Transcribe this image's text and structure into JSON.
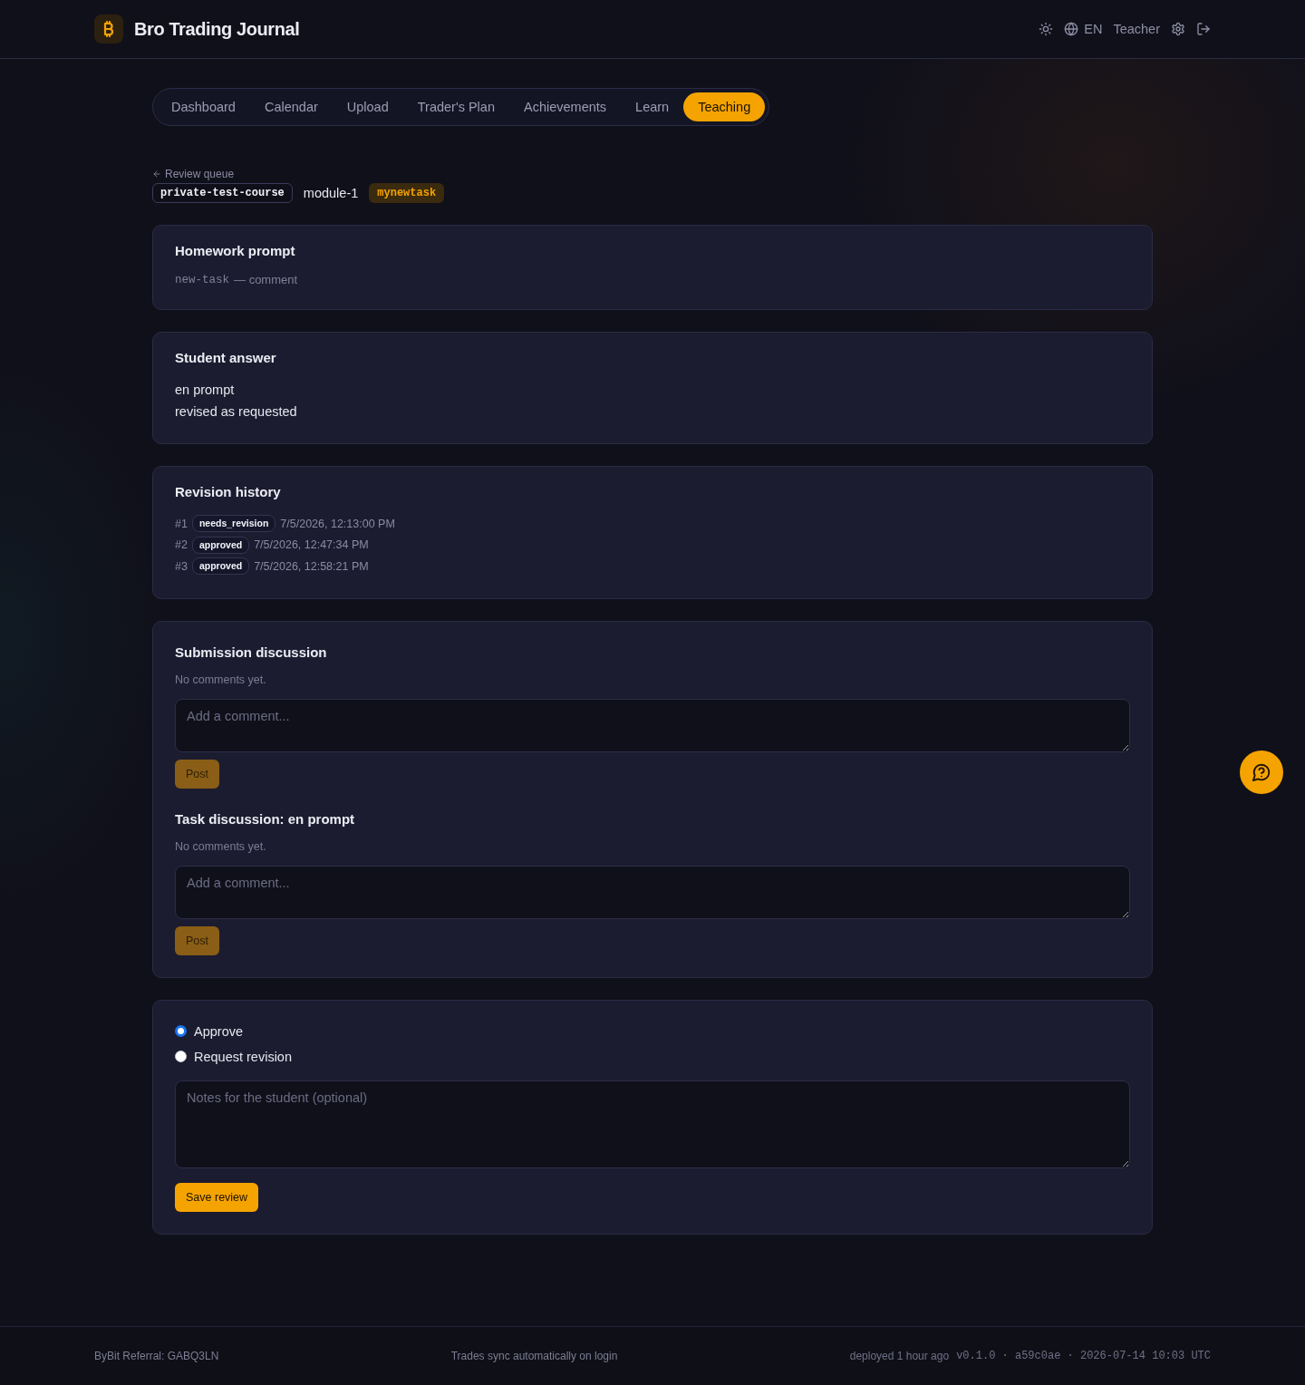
{
  "header": {
    "title": "Bro Trading Journal",
    "language": "EN",
    "role": "Teacher"
  },
  "nav": {
    "tabs": [
      {
        "label": "Dashboard",
        "selected": false
      },
      {
        "label": "Calendar",
        "selected": false
      },
      {
        "label": "Upload",
        "selected": false
      },
      {
        "label": "Trader's Plan",
        "selected": false
      },
      {
        "label": "Achievements",
        "selected": false
      },
      {
        "label": "Learn",
        "selected": false
      },
      {
        "label": "Teaching",
        "selected": true
      }
    ]
  },
  "breadcrumb": {
    "back_link": "Review queue",
    "course": "private-test-course",
    "module": "module-1",
    "task": "mynewtask"
  },
  "homework_prompt": {
    "title": "Homework prompt",
    "task": "new-task",
    "comment": "— comment"
  },
  "student_answer": {
    "title": "Student answer",
    "lines": [
      "en prompt",
      "revised as requested"
    ]
  },
  "revision_history": {
    "title": "Revision history",
    "entries": [
      {
        "number": "#1",
        "status": "needs_revision",
        "date": "7/5/2026, 12:13:00 PM"
      },
      {
        "number": "#2",
        "status": "approved",
        "date": "7/5/2026, 12:47:34 PM"
      },
      {
        "number": "#3",
        "status": "approved",
        "date": "7/5/2026, 12:58:21 PM"
      }
    ]
  },
  "discussions": [
    {
      "title": "Submission discussion",
      "empty_text": "No comments yet.",
      "comment_field": {
        "placeholder": "Add a comment..."
      },
      "button": {
        "label": "Post",
        "disabled": true
      }
    },
    {
      "title": "Task discussion: en prompt",
      "empty_text": "No comments yet.",
      "comment_field": {
        "placeholder": "Add a comment..."
      },
      "button": {
        "label": "Post",
        "disabled": true
      }
    }
  ],
  "review": {
    "options": [
      {
        "label": "Approve",
        "selected": true
      },
      {
        "label": "Request revision",
        "selected": false
      }
    ],
    "notes": {
      "placeholder": "Notes for the student (optional)"
    },
    "button": {
      "label": "Save review",
      "disabled": false
    }
  },
  "footer": {
    "referral": "ByBit Referral: GABQ3LN",
    "sync_note": "Trades sync automatically on login",
    "deployed": "deployed 1 hour ago",
    "build": "v0.1.0 · a59c0ae · 2026-07-14 10:03 UTC"
  }
}
